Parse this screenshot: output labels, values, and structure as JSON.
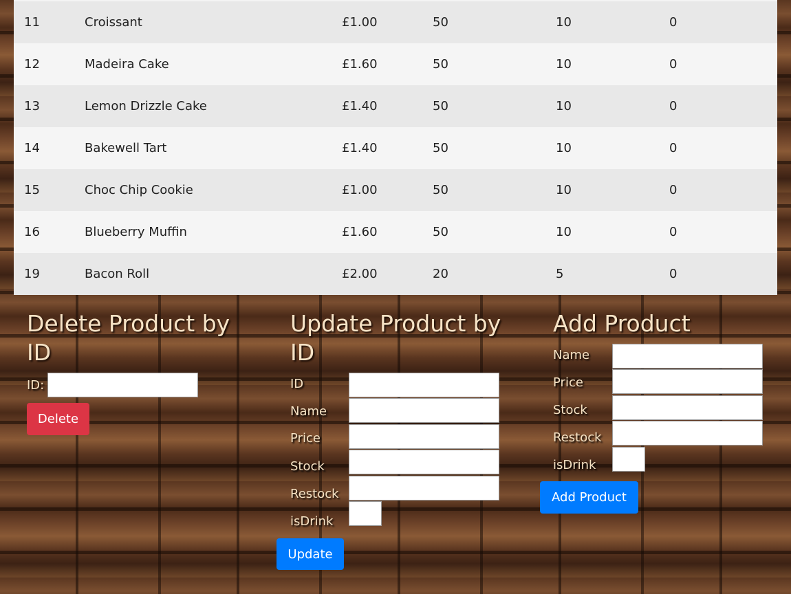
{
  "products": [
    {
      "id": "11",
      "name": "Croissant",
      "price": "£1.00",
      "stock": "50",
      "restock": "10",
      "is_drink": "0"
    },
    {
      "id": "12",
      "name": "Madeira Cake",
      "price": "£1.60",
      "stock": "50",
      "restock": "10",
      "is_drink": "0"
    },
    {
      "id": "13",
      "name": "Lemon Drizzle Cake",
      "price": "£1.40",
      "stock": "50",
      "restock": "10",
      "is_drink": "0"
    },
    {
      "id": "14",
      "name": "Bakewell Tart",
      "price": "£1.40",
      "stock": "50",
      "restock": "10",
      "is_drink": "0"
    },
    {
      "id": "15",
      "name": "Choc Chip Cookie",
      "price": "£1.00",
      "stock": "50",
      "restock": "10",
      "is_drink": "0"
    },
    {
      "id": "16",
      "name": "Blueberry Muffin",
      "price": "£1.60",
      "stock": "50",
      "restock": "10",
      "is_drink": "0"
    },
    {
      "id": "19",
      "name": "Bacon Roll",
      "price": "£2.00",
      "stock": "20",
      "restock": "5",
      "is_drink": "0"
    }
  ],
  "delete_form": {
    "title": "Delete Product by ID",
    "id_label": "ID:",
    "id_value": "",
    "button": "Delete"
  },
  "update_form": {
    "title": "Update Product by ID",
    "labels": {
      "id": "ID",
      "name": "Name",
      "price": "Price",
      "stock": "Stock",
      "restock": "Restock",
      "is_drink": "isDrink"
    },
    "values": {
      "id": "",
      "name": "",
      "price": "",
      "stock": "",
      "restock": "",
      "is_drink": ""
    },
    "button": "Update"
  },
  "add_form": {
    "title": "Add Product",
    "labels": {
      "name": "Name",
      "price": "Price",
      "stock": "Stock",
      "restock": "Restock",
      "is_drink": "isDrink"
    },
    "values": {
      "name": "",
      "price": "",
      "stock": "",
      "restock": "",
      "is_drink": ""
    },
    "button": "Add Product"
  },
  "colors": {
    "delete_button": "#dc3545",
    "primary_button": "#007bff",
    "heading_text": "#f6e3c6"
  }
}
